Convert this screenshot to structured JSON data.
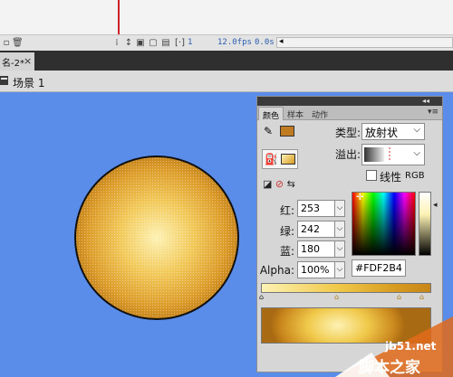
{
  "timeline": {
    "frame_number": "1",
    "fps": "12.0fps",
    "time": "0.0s"
  },
  "document_tab": {
    "label": "名-2*",
    "close": "×"
  },
  "edit_bar": {
    "scene": "场景 1"
  },
  "panel": {
    "collapse": "◂◂",
    "tabs": [
      "颜色",
      "样本",
      "动作"
    ],
    "menu": "▾≡",
    "type_label": "类型:",
    "type_value": "放射状",
    "overflow_label": "溢出:",
    "linear_label": "线性 RGB",
    "linear_text": "线性",
    "rgb_text": "RGB",
    "red_label": "红:",
    "red_value": "253",
    "green_label": "绿:",
    "green_value": "242",
    "blue_label": "蓝:",
    "blue_value": "180",
    "alpha_label": "Alpha:",
    "alpha_value": "100%",
    "hex_value": "#FDF2B4",
    "stroke_color": "#c07a20",
    "fill_color": "#e8a030",
    "selected_color": "#FDF2B4"
  },
  "watermark": {
    "site": "jb51.net",
    "brand": "脚本之家"
  }
}
